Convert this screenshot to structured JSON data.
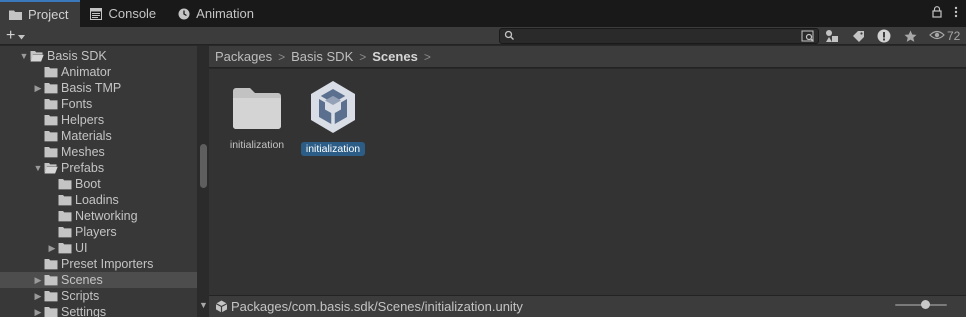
{
  "tabs": [
    {
      "label": "Project",
      "icon": "folder-icon",
      "active": true
    },
    {
      "label": "Console",
      "icon": "console-icon",
      "active": false
    },
    {
      "label": "Animation",
      "icon": "animation-icon",
      "active": false
    }
  ],
  "toolbar": {
    "add_label": "+",
    "search_placeholder": "",
    "eye_count": "72"
  },
  "tree": [
    {
      "label": "Basis SDK",
      "depth": 1,
      "arrow": "expanded",
      "open": true
    },
    {
      "label": "Animator",
      "depth": 2,
      "arrow": "none"
    },
    {
      "label": "Basis TMP",
      "depth": 2,
      "arrow": "collapsed"
    },
    {
      "label": "Fonts",
      "depth": 2,
      "arrow": "none"
    },
    {
      "label": "Helpers",
      "depth": 2,
      "arrow": "none"
    },
    {
      "label": "Materials",
      "depth": 2,
      "arrow": "none"
    },
    {
      "label": "Meshes",
      "depth": 2,
      "arrow": "none"
    },
    {
      "label": "Prefabs",
      "depth": 2,
      "arrow": "expanded",
      "open": true
    },
    {
      "label": "Boot",
      "depth": 3,
      "arrow": "none"
    },
    {
      "label": "Loadins",
      "depth": 3,
      "arrow": "none"
    },
    {
      "label": "Networking",
      "depth": 3,
      "arrow": "none"
    },
    {
      "label": "Players",
      "depth": 3,
      "arrow": "none"
    },
    {
      "label": "UI",
      "depth": 3,
      "arrow": "collapsed"
    },
    {
      "label": "Preset Importers",
      "depth": 2,
      "arrow": "none"
    },
    {
      "label": "Scenes",
      "depth": 2,
      "arrow": "collapsed",
      "selected": true
    },
    {
      "label": "Scripts",
      "depth": 2,
      "arrow": "collapsed"
    },
    {
      "label": "Settings",
      "depth": 2,
      "arrow": "collapsed"
    }
  ],
  "breadcrumb": [
    "Packages",
    "Basis SDK",
    "Scenes"
  ],
  "breadcrumb_sep": ">",
  "assets": [
    {
      "label": "initialization",
      "icon": "folder-icon",
      "selected": false
    },
    {
      "label": "initialization",
      "icon": "unity-scene-icon",
      "selected": true
    }
  ],
  "status": {
    "path": "Packages/com.basis.sdk/Scenes/initialization.unity"
  },
  "icon_size_slider": 0.6,
  "colors": {
    "accent": "#3a79bb",
    "selection": "#2c5d87",
    "panel": "#383838",
    "content": "#333333"
  }
}
